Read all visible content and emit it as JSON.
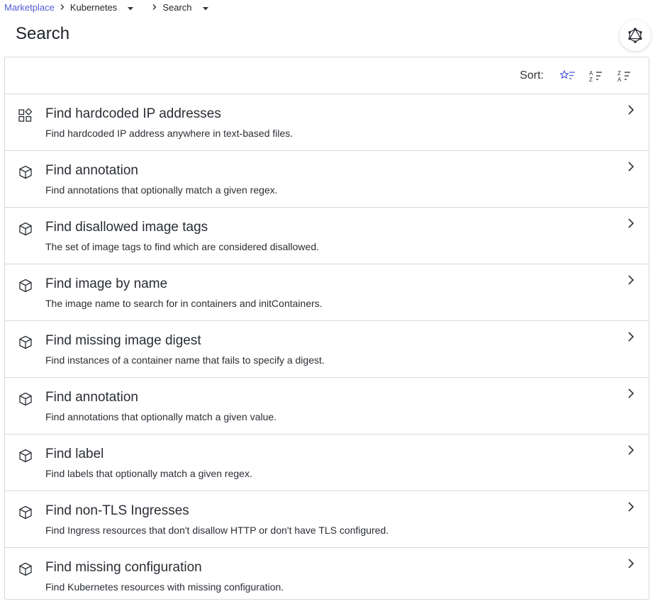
{
  "breadcrumb": {
    "items": [
      {
        "label": "Marketplace"
      },
      {
        "label": "Kubernetes"
      },
      {
        "label": "Search"
      }
    ]
  },
  "page": {
    "title": "Search"
  },
  "sort": {
    "label": "Sort:",
    "options": [
      {
        "icon": "star-sort-icon",
        "active": true
      },
      {
        "icon": "sort-a-z-icon",
        "active": false
      },
      {
        "icon": "sort-z-a-icon",
        "active": false
      }
    ]
  },
  "colors": {
    "accent": "#4f5bd5",
    "border": "#d8d8dc"
  },
  "recipes": [
    {
      "title": "Find hardcoded IP addresses",
      "description": "Find hardcoded IP address anywhere in text-based files.",
      "icon": "grid-icon"
    },
    {
      "title": "Find annotation",
      "description": "Find annotations that optionally match a given regex.",
      "icon": "cube-icon"
    },
    {
      "title": "Find disallowed image tags",
      "description": "The set of image tags to find which are considered disallowed.",
      "icon": "cube-icon"
    },
    {
      "title": "Find image by name",
      "description": "The image name to search for in containers and initContainers.",
      "icon": "cube-icon"
    },
    {
      "title": "Find missing image digest",
      "description": "Find instances of a container name that fails to specify a digest.",
      "icon": "cube-icon"
    },
    {
      "title": "Find annotation",
      "description": "Find annotations that optionally match a given value.",
      "icon": "cube-icon"
    },
    {
      "title": "Find label",
      "description": "Find labels that optionally match a given regex.",
      "icon": "cube-icon"
    },
    {
      "title": "Find non-TLS Ingresses",
      "description": "Find Ingress resources that don't disallow HTTP or don't have TLS configured.",
      "icon": "cube-icon"
    },
    {
      "title": "Find missing configuration",
      "description": "Find Kubernetes resources with missing configuration.",
      "icon": "cube-icon"
    }
  ]
}
